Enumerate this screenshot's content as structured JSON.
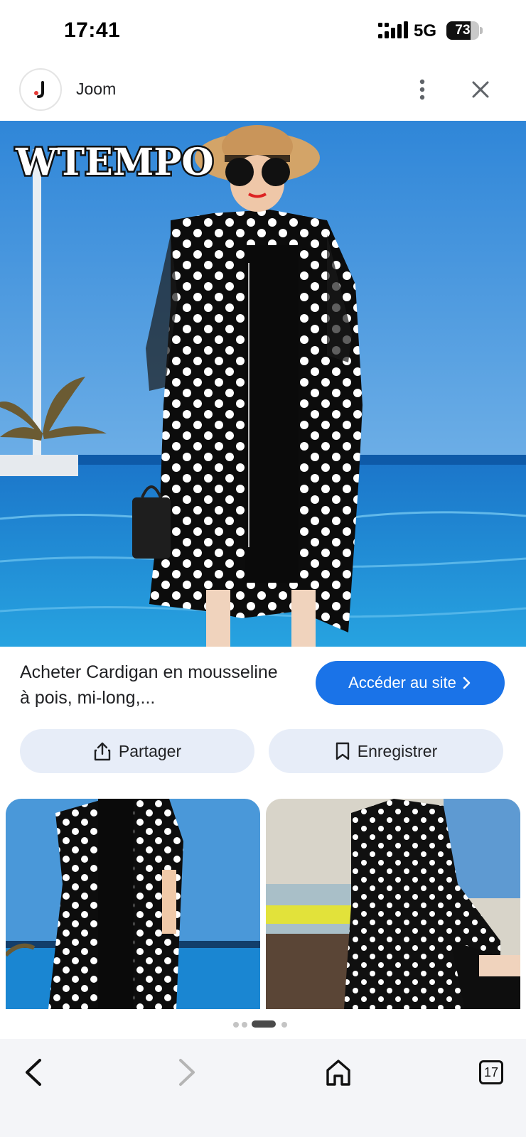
{
  "status_bar": {
    "time": "17:41",
    "network": "5G",
    "battery_percent": "73",
    "battery_level": 0.73
  },
  "header": {
    "site_name": "Joom",
    "favicon_icon": "joom-logo-icon",
    "more_icon": "more-vertical-icon",
    "close_icon": "close-icon"
  },
  "hero": {
    "watermark": "WTEMPO",
    "image_subject": "woman in black polka-dot chiffon cardigan over black dress by pool"
  },
  "result": {
    "title": "Acheter Cardigan en mousseline à pois, mi-long,...",
    "visit_label": "Accéder au site",
    "visit_icon": "chevron-right-icon"
  },
  "actions": {
    "share_label": "Partager",
    "share_icon": "share-icon",
    "save_label": "Enregistrer",
    "save_icon": "bookmark-icon"
  },
  "related": [
    {
      "subject": "polka-dot cardigan by the sea"
    },
    {
      "subject": "polka-dot cardigan seated indoors"
    }
  ],
  "pager": {
    "count": 4,
    "active_index": 2
  },
  "bottom_nav": {
    "back_icon": "back-arrow-icon",
    "forward_icon": "forward-arrow-icon",
    "home_icon": "home-icon",
    "tabs_count": "17"
  },
  "colors": {
    "accent": "#1a73e8",
    "chip_bg": "#e7edf8",
    "nav_bg": "#f4f5f8",
    "text": "#202124"
  }
}
